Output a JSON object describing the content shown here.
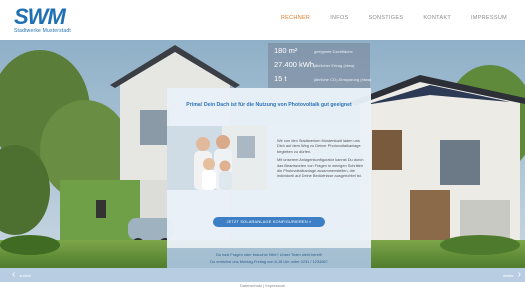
{
  "header": {
    "logo_mark": "SWM",
    "logo_sub": "Stadtwerke Musterstadt",
    "nav": [
      "RECHNER",
      "INFOS",
      "SONSTIGES",
      "KONTAKT",
      "IMPRESSUM"
    ],
    "active_nav": "RECHNER"
  },
  "stats": [
    {
      "value": "180 m²",
      "label": "geeignete Dachfläche"
    },
    {
      "value": "27.400 kWh",
      "label": "jährlicher Ertrag (etwa)"
    },
    {
      "value": "15 t",
      "label": "jährliche CO₂-Einsparung (etwa)"
    }
  ],
  "panel": {
    "title": "Prima! Dein Dach ist für die Nutzung von Photovoltaik gut geeignet",
    "text_1": "Wir von den Stadtwerken Musterstadt laden uns Dich auf dem Weg zu Deiner Photovoltaikanlage begleiten zu dürfen.",
    "text_2": "Mit unserem Anlagenkonfigurator kannst Du durch das Beantworten von Fragen in wenigen Schritten die Photovoltaikanlage zusammenstellen, die individuell auf Deine Bedürfnisse ausgerichtet ist.",
    "cta": "JETZT SOLARANLAGE KONFIGURIEREN »"
  },
  "contact": {
    "line_1": "Du hast Fragen oder brauchst Hilfe? Unser Team steht bereit!",
    "line_2": "Du erreichst uns Montag-Freitag von 8-18 Uhr unter 0231 / 123456?"
  },
  "bottom": {
    "prev_label": "zurück",
    "next_label": "weiter"
  },
  "footer": {
    "text": "Datenschutz | Impressum"
  },
  "colors": {
    "brand_blue": "#1f6fb3",
    "accent_orange": "#e07a2e",
    "cta_blue": "#3d7fc4"
  }
}
